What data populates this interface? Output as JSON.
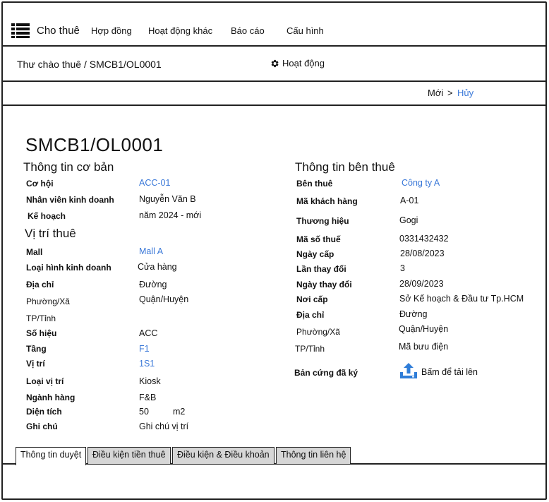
{
  "nav": {
    "brand": "Cho thuê",
    "items": [
      "Hợp đồng",
      "Hoạt động khác",
      "Báo cáo",
      "Cấu hình"
    ]
  },
  "breadcrumb": "Thư chào thuê / SMCB1/OL0001",
  "activity_label": "Hoạt động",
  "status": {
    "current": "Mới",
    "chevron": ">",
    "cancel": "Hủy"
  },
  "record_title": "SMCB1/OL0001",
  "basic": {
    "title": "Thông tin cơ bản",
    "opportunity_label": "Cơ hội",
    "opportunity_value": "ACC-01",
    "salesperson_label": "Nhân viên kinh doanh",
    "salesperson_value": "Nguyễn Văn B",
    "plan_label": "Kế hoạch",
    "plan_value": "năm 2024 - mới"
  },
  "location": {
    "title": "Vị trí thuê",
    "mall_label": "Mall",
    "mall_value": "Mall A",
    "business_type_label": "Loại hình kinh doanh",
    "business_type_value": "Cửa hàng",
    "address_label": "Địa chỉ",
    "address_value": "Đường",
    "ward_label": "Phường/Xã",
    "ward_value": "Quận/Huyện",
    "city_label": "TP/Tỉnh",
    "number_label": "Số hiệu",
    "number_value": "ACC",
    "floor_label": "Tầng",
    "floor_value": "F1",
    "position_label": "Vị trí",
    "position_value": "1S1",
    "position_type_label": "Loại vị trí",
    "position_type_value": "Kiosk",
    "category_label": "Ngành hàng",
    "category_value": "F&B",
    "area_label": "Diện tích",
    "area_value": "50",
    "area_unit": "m2",
    "note_label": "Ghi chú",
    "note_value": "Ghi chú vị trí"
  },
  "tenant": {
    "title": "Thông tin bên thuê",
    "tenant_label": "Bên thuê",
    "tenant_value": "Công ty A",
    "customer_code_label": "Mã khách hàng",
    "customer_code_value": "A-01",
    "brand_label": "Thương hiệu",
    "brand_value": "Gogi",
    "tax_code_label": "Mã số thuế",
    "tax_code_value": "0331432432",
    "issue_date_label": "Ngày cấp",
    "issue_date_value": "28/08/2023",
    "change_count_label": "Lần thay đổi",
    "change_count_value": "3",
    "change_date_label": "Ngày thay đổi",
    "change_date_value": "28/09/2023",
    "issuer_label": "Nơi cấp",
    "issuer_value": "Sở Kế hoạch & Đầu tư Tp.HCM",
    "address_label": "Địa chỉ",
    "address_value": "Đường",
    "ward_label": "Phường/Xã",
    "ward_value": "Quận/Huyện",
    "city_label": "TP/Tỉnh",
    "city_value": "Mã bưu điện",
    "signed_copy_label": "Bản cứng đã ký",
    "upload_label": "Bấm để tải lên"
  },
  "tabs": [
    "Thông tin duyệt",
    "Điều kiện tiền thuê",
    "Điều kiện & Điều khoản",
    "Thông tin liên hệ"
  ],
  "colors": {
    "link": "#3a78d8",
    "tab_inactive": "#d6d6d6",
    "border": "#222222"
  },
  "icons": {
    "menu": "list-menu-icon",
    "activity": "gear-icon",
    "upload": "upload-icon"
  }
}
